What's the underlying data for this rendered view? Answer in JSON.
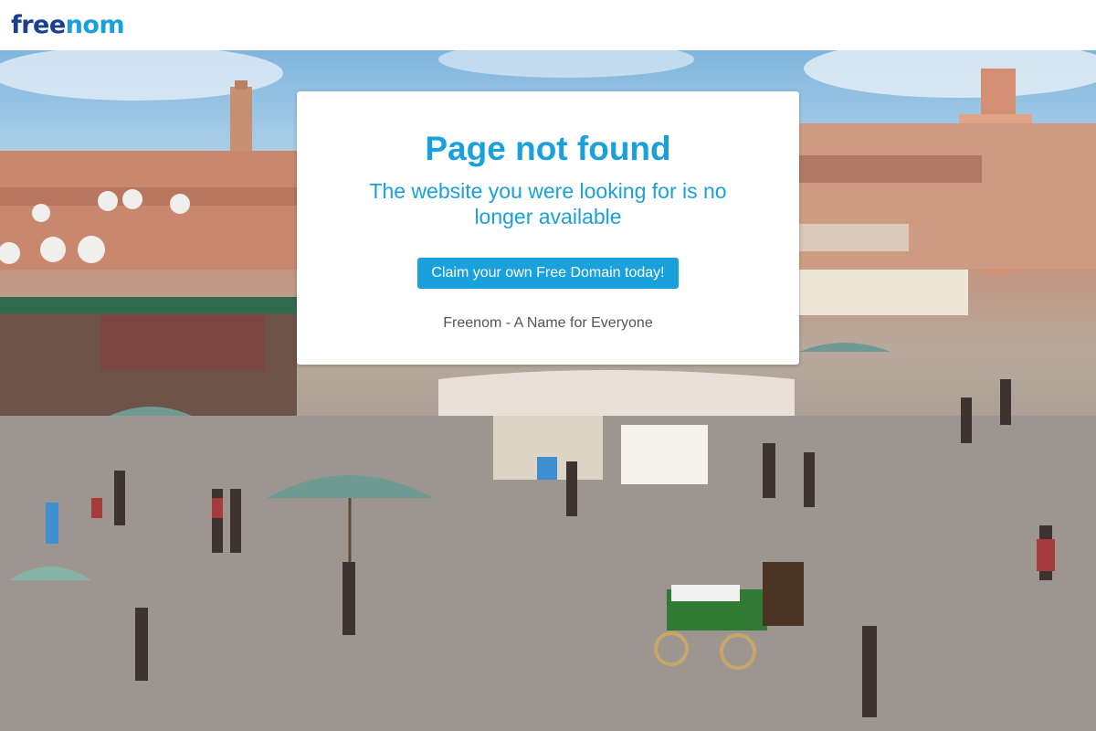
{
  "brand": {
    "logo_part1": "free",
    "logo_part2": "nom",
    "color_dark": "#1b3f8f",
    "color_light": "#1aa0dc"
  },
  "hero": {
    "icon": "marketplace-photo"
  },
  "error_card": {
    "title": "Page not found",
    "subtitle": "The website you were looking for is no longer available",
    "cta_label": "Claim your own Free Domain today!",
    "tagline": "Freenom - A Name for Everyone",
    "accent_color": "#1aa0dc",
    "tagline_color": "#555555"
  }
}
